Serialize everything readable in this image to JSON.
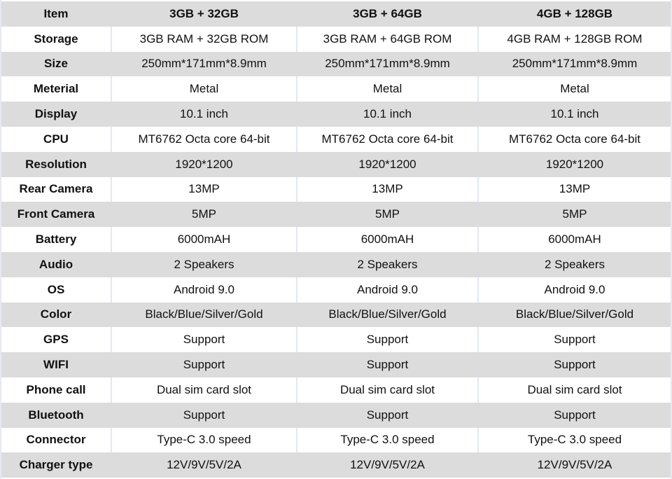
{
  "table": {
    "header": [
      "Item",
      "3GB + 32GB",
      "3GB + 64GB",
      "4GB + 128GB"
    ],
    "rows": [
      {
        "label": "Storage",
        "values": [
          "3GB RAM + 32GB ROM",
          "3GB RAM + 64GB ROM",
          "4GB RAM + 128GB ROM"
        ]
      },
      {
        "label": "Size",
        "values": [
          "250mm*171mm*8.9mm",
          "250mm*171mm*8.9mm",
          "250mm*171mm*8.9mm"
        ]
      },
      {
        "label": "Meterial",
        "values": [
          "Metal",
          "Metal",
          "Metal"
        ]
      },
      {
        "label": "Display",
        "values": [
          "10.1 inch",
          "10.1 inch",
          "10.1 inch"
        ]
      },
      {
        "label": "CPU",
        "values": [
          "MT6762 Octa core 64-bit",
          "MT6762 Octa core 64-bit",
          "MT6762 Octa core 64-bit"
        ]
      },
      {
        "label": "Resolution",
        "values": [
          "1920*1200",
          "1920*1200",
          "1920*1200"
        ]
      },
      {
        "label": "Rear Camera",
        "values": [
          "13MP",
          "13MP",
          "13MP"
        ]
      },
      {
        "label": "Front Camera",
        "values": [
          "5MP",
          "5MP",
          "5MP"
        ]
      },
      {
        "label": "Battery",
        "values": [
          "6000mAH",
          "6000mAH",
          "6000mAH"
        ]
      },
      {
        "label": "Audio",
        "values": [
          "2 Speakers",
          "2 Speakers",
          "2 Speakers"
        ]
      },
      {
        "label": "OS",
        "values": [
          "Android 9.0",
          "Android 9.0",
          "Android 9.0"
        ]
      },
      {
        "label": "Color",
        "values": [
          "Black/Blue/Silver/Gold",
          "Black/Blue/Silver/Gold",
          "Black/Blue/Silver/Gold"
        ]
      },
      {
        "label": "GPS",
        "values": [
          "Support",
          "Support",
          "Support"
        ]
      },
      {
        "label": "WIFI",
        "values": [
          "Support",
          "Support",
          "Support"
        ]
      },
      {
        "label": "Phone call",
        "values": [
          "Dual sim card slot",
          "Dual sim card slot",
          "Dual sim card slot"
        ]
      },
      {
        "label": "Bluetooth",
        "values": [
          "Support",
          "Support",
          "Support"
        ]
      },
      {
        "label": "Connector",
        "values": [
          "Type-C 3.0 speed",
          "Type-C 3.0 speed",
          "Type-C 3.0 speed"
        ]
      },
      {
        "label": "Charger type",
        "values": [
          "12V/9V/5V/2A",
          "12V/9V/5V/2A",
          "12V/9V/5V/2A"
        ]
      }
    ]
  },
  "colors": {
    "stripe_gray": "#dcdcdc",
    "stripe_white": "#ffffff",
    "divider": "#e3e8f2",
    "text": "#111111"
  }
}
